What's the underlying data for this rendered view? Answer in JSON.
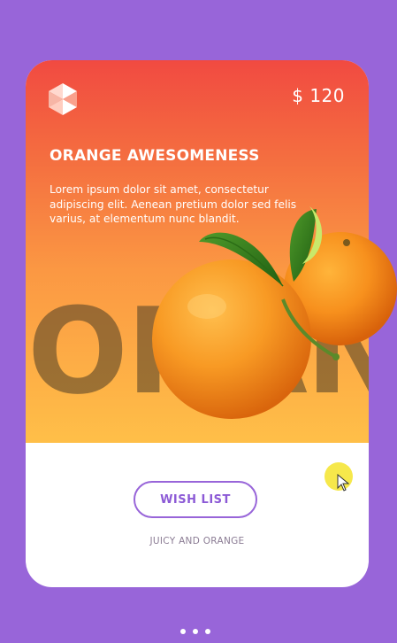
{
  "card": {
    "price": "$ 120",
    "title": "ORANGE AWESOMENESS",
    "description": "Lorem ipsum dolor sit amet, consectetur adipiscing elit. Aenean pretium dolor sed felis varius, at elementum nunc blandit.",
    "background_word": "ORAN",
    "wish_list_label": "WISH LIST",
    "subtitle": "JUICY AND ORANGE"
  },
  "pager": {
    "dots": 3,
    "active_index": 0
  },
  "colors": {
    "page_background": "#9865d9",
    "hero_gradient_top": "#f14a41",
    "hero_gradient_bottom": "#ffbf48",
    "button_accent": "#9865d9",
    "cursor_highlight": "#f6e84b"
  },
  "icons": {
    "logo": "brand-logo-icon",
    "fruit": "oranges-image",
    "cursor": "mouse-pointer-icon"
  }
}
